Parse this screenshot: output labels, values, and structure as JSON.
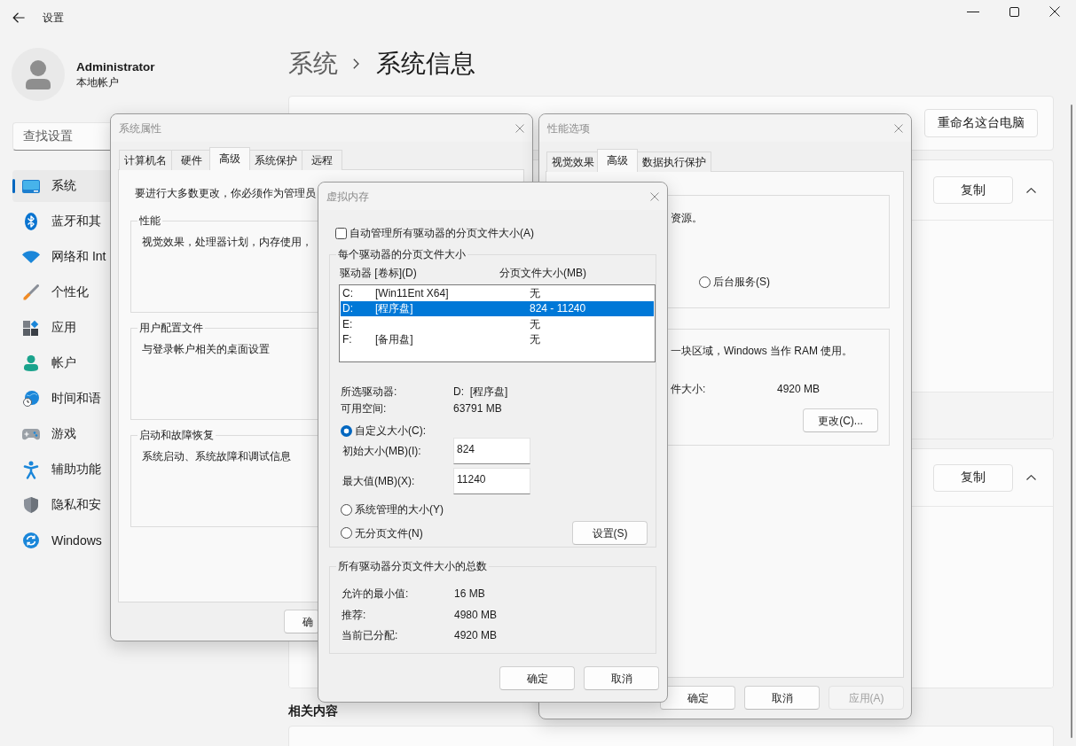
{
  "settings": {
    "title": "设置",
    "user": {
      "name": "Administrator",
      "account": "本地帐户"
    },
    "search": {
      "placeholder": "查找设置"
    },
    "nav": [
      {
        "label": "系统",
        "selected": true
      },
      {
        "label": "蓝牙和其",
        "selected": false
      },
      {
        "label": "网络和 Int",
        "selected": false
      },
      {
        "label": "个性化",
        "selected": false
      },
      {
        "label": "应用",
        "selected": false
      },
      {
        "label": "帐户",
        "selected": false
      },
      {
        "label": "时间和语",
        "selected": false
      },
      {
        "label": "游戏",
        "selected": false
      },
      {
        "label": "辅助功能",
        "selected": false
      },
      {
        "label": "隐私和安",
        "selected": false
      },
      {
        "label": "Windows",
        "selected": false
      }
    ],
    "breadcrumb": {
      "parent": "系统",
      "current": "系统信息"
    },
    "rename_button": "重命名这台电脑",
    "sections": [
      {
        "button": "复制",
        "expanded": true
      },
      {
        "button": "复制",
        "expanded": true
      }
    ],
    "related_heading": "相关内容"
  },
  "system_properties": {
    "title": "系统属性",
    "tabs": [
      {
        "label": "计算机名",
        "selected": false
      },
      {
        "label": "硬件",
        "selected": false
      },
      {
        "label": "高级",
        "selected": true
      },
      {
        "label": "系统保护",
        "selected": false
      },
      {
        "label": "远程",
        "selected": false
      }
    ],
    "notice": "要进行大多数更改，你必须作为管理员",
    "groups": [
      {
        "label": "性能",
        "text": "视觉效果，处理器计划，内存使用，"
      },
      {
        "label": "用户配置文件",
        "text": "与登录帐户相关的桌面设置"
      },
      {
        "label": "启动和故障恢复",
        "text": "系统启动、系统故障和调试信息"
      }
    ],
    "buttons": [
      "确"
    ]
  },
  "performance_options": {
    "title": "性能选项",
    "tabs": [
      {
        "label": "视觉效果",
        "selected": false
      },
      {
        "label": "高级",
        "selected": true
      },
      {
        "label": "数据执行保护",
        "selected": false
      }
    ],
    "scheduling": {
      "text": "资源。",
      "options": [
        {
          "label": "后台服务(S)",
          "selected": false
        }
      ]
    },
    "paging": {
      "text": "一块区域，Windows 当作 RAM 使用。",
      "total_label": "件大小:",
      "total_value": "4920 MB",
      "button": "更改(C)..."
    },
    "buttons": [
      {
        "label": "确定",
        "disabled": false
      },
      {
        "label": "取消",
        "disabled": false
      },
      {
        "label": "应用(A)",
        "disabled": true
      }
    ]
  },
  "virtual_memory": {
    "title": "虚拟内存",
    "auto_manage": {
      "label": "自动管理所有驱动器的分页文件大小(A)",
      "checked": false
    },
    "per_drive": {
      "label": "每个驱动器的分页文件大小",
      "columns": [
        "驱动器 [卷标](D)",
        "分页文件大小(MB)"
      ],
      "drives": [
        {
          "letter": "C:",
          "volume": "[Win11Ent X64]",
          "size": "无",
          "selected": false
        },
        {
          "letter": "D:",
          "volume": "[程序盘]",
          "size": "824 - 11240",
          "selected": true
        },
        {
          "letter": "E:",
          "size": "无",
          "selected": false
        },
        {
          "letter": "F:",
          "volume": "[备用盘]",
          "size": "无",
          "selected": false
        }
      ],
      "details": [
        {
          "label": "所选驱动器:",
          "value": "D:  [程序盘]"
        },
        {
          "label": "可用空间:",
          "value": "63791 MB"
        }
      ],
      "size_options": [
        {
          "label": "自定义大小(C):",
          "selected": true,
          "fields": [
            {
              "label": "初始大小(MB)(I):",
              "value": "824"
            },
            {
              "label": "最大值(MB)(X):",
              "value": "11240"
            }
          ]
        },
        {
          "label": "系统管理的大小(Y)",
          "selected": false
        },
        {
          "label": "无分页文件(N)",
          "selected": false
        }
      ],
      "set_button": "设置(S)"
    },
    "totals": {
      "label": "所有驱动器分页文件大小的总数",
      "rows": [
        {
          "label": "允许的最小值:",
          "value": "16 MB"
        },
        {
          "label": "推荐:",
          "value": "4980 MB"
        },
        {
          "label": "当前已分配:",
          "value": "4920 MB"
        }
      ]
    },
    "buttons": [
      "确定",
      "取消"
    ]
  }
}
